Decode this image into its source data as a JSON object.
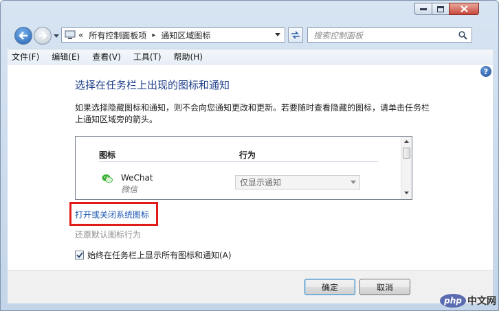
{
  "window": {
    "caption_buttons": [
      "minimize",
      "maximize",
      "close"
    ]
  },
  "address_bar": {
    "prefix": "«",
    "crumb1": "所有控制面板项",
    "separator": "▸",
    "crumb2": "通知区域图标",
    "search_placeholder": "搜索控制面板"
  },
  "menu": [
    "文件(F)",
    "编辑(E)",
    "查看(V)",
    "工具(T)",
    "帮助(H)"
  ],
  "content": {
    "title": "选择在任务栏上出现的图标和通知",
    "description": "如果选择隐藏图标和通知，则不会向您通知更改和更新。若要随时查看隐藏的图标，请单击任务栏上通知区域旁的箭头。",
    "table": {
      "col_icon": "图标",
      "col_behavior": "行为",
      "rows": [
        {
          "name": "WeChat",
          "subtitle": "微信",
          "behavior": "仅显示通知"
        }
      ]
    },
    "link_system_icons": "打开或关闭系统图标",
    "link_restore_defaults": "还原默认图标行为",
    "checkbox_label": "始终在任务栏上显示所有图标和通知(A)",
    "checkbox_checked": true
  },
  "buttons": {
    "ok": "确定",
    "cancel": "取消"
  },
  "watermark": {
    "logo": "php",
    "text": "中文网"
  },
  "colors": {
    "title_blue": "#1f3f8a",
    "link_blue": "#1a55b0",
    "highlight_red": "#e11a1a",
    "wechat_green": "#3cb034"
  }
}
